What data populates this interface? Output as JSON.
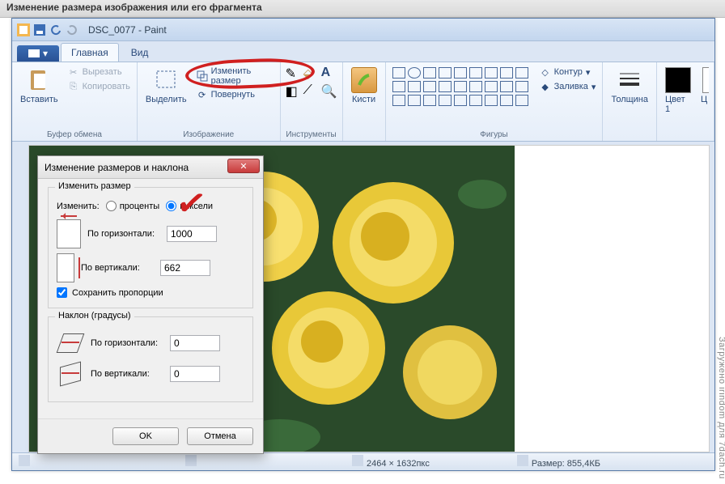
{
  "outer_title": "Изменение размера изображения или его фрагмента",
  "document_title": "DSC_0077 - Paint",
  "tabs": {
    "home": "Главная",
    "view": "Вид"
  },
  "ribbon": {
    "clipboard": {
      "label": "Буфер обмена",
      "paste": "Вставить",
      "cut": "Вырезать",
      "copy": "Копировать"
    },
    "image": {
      "label": "Изображение",
      "select": "Выделить",
      "resize": "Изменить размер",
      "rotate": "Повернуть"
    },
    "tools": {
      "label": "Инструменты"
    },
    "brushes": {
      "label": "Кисти"
    },
    "shapes": {
      "label": "Фигуры",
      "outline": "Контур",
      "fill": "Заливка"
    },
    "thickness": {
      "label": "Толщина"
    },
    "color1": {
      "label": "Цвет 1"
    },
    "color2": {
      "label": "Ц"
    }
  },
  "dialog": {
    "title": "Изменение размеров и наклона",
    "resize_legend": "Изменить размер",
    "by_label": "Изменить:",
    "percent": "проценты",
    "pixels": "пиксели",
    "horizontal": "По горизонтали:",
    "vertical": "По вертикали:",
    "h_value": "1000",
    "v_value": "662",
    "keep_aspect": "Сохранить пропорции",
    "skew_legend": "Наклон (градусы)",
    "skew_h": "0",
    "skew_v": "0",
    "ok": "OK",
    "cancel": "Отмена"
  },
  "status": {
    "dimensions": "2464 × 1632пкс",
    "size_label": "Размер: 855,4КБ"
  },
  "watermark": "Загружено irindom для 7dach.ru"
}
